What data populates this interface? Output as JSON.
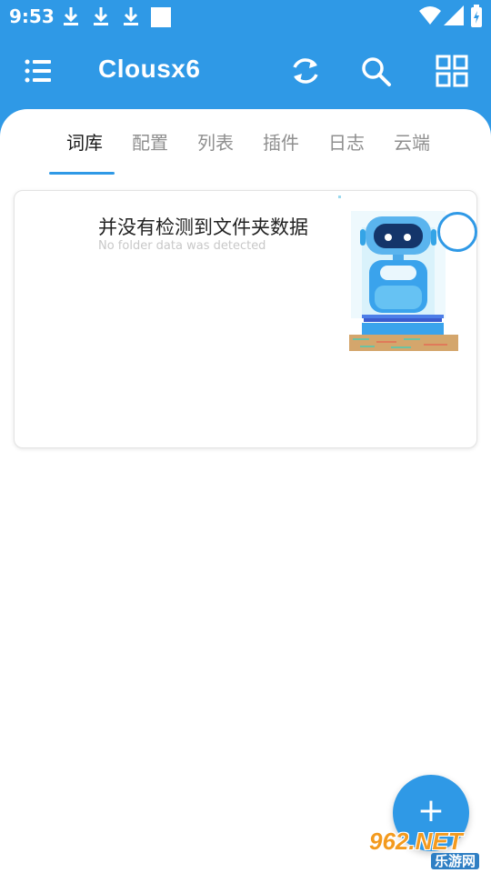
{
  "status_bar": {
    "time": "9:53",
    "icons": [
      "download-icon",
      "download-icon",
      "download-icon",
      "notification-square-icon",
      "wifi-icon",
      "signal-icon",
      "battery-icon"
    ]
  },
  "toolbar": {
    "title": "Clousx6",
    "icons": [
      "menu-icon",
      "refresh-icon",
      "search-icon",
      "grid-icon"
    ]
  },
  "tabs": [
    {
      "label": "词库",
      "active": true
    },
    {
      "label": "配置",
      "active": false
    },
    {
      "label": "列表",
      "active": false
    },
    {
      "label": "插件",
      "active": false
    },
    {
      "label": "日志",
      "active": false
    },
    {
      "label": "云端",
      "active": false
    }
  ],
  "empty_card": {
    "title": "并没有检测到文件夹数据",
    "subtitle": "No folder data was detected",
    "illustration": "robot-illustration"
  },
  "fab": {
    "label": "+",
    "icon": "add-icon"
  },
  "watermark": {
    "top": "962.NET",
    "bottom": "乐游网"
  },
  "colors": {
    "primary": "#2f99e6",
    "background": "#ffffff",
    "tab_active": "#1a1a1a",
    "tab_inactive": "#8f8f8f"
  }
}
